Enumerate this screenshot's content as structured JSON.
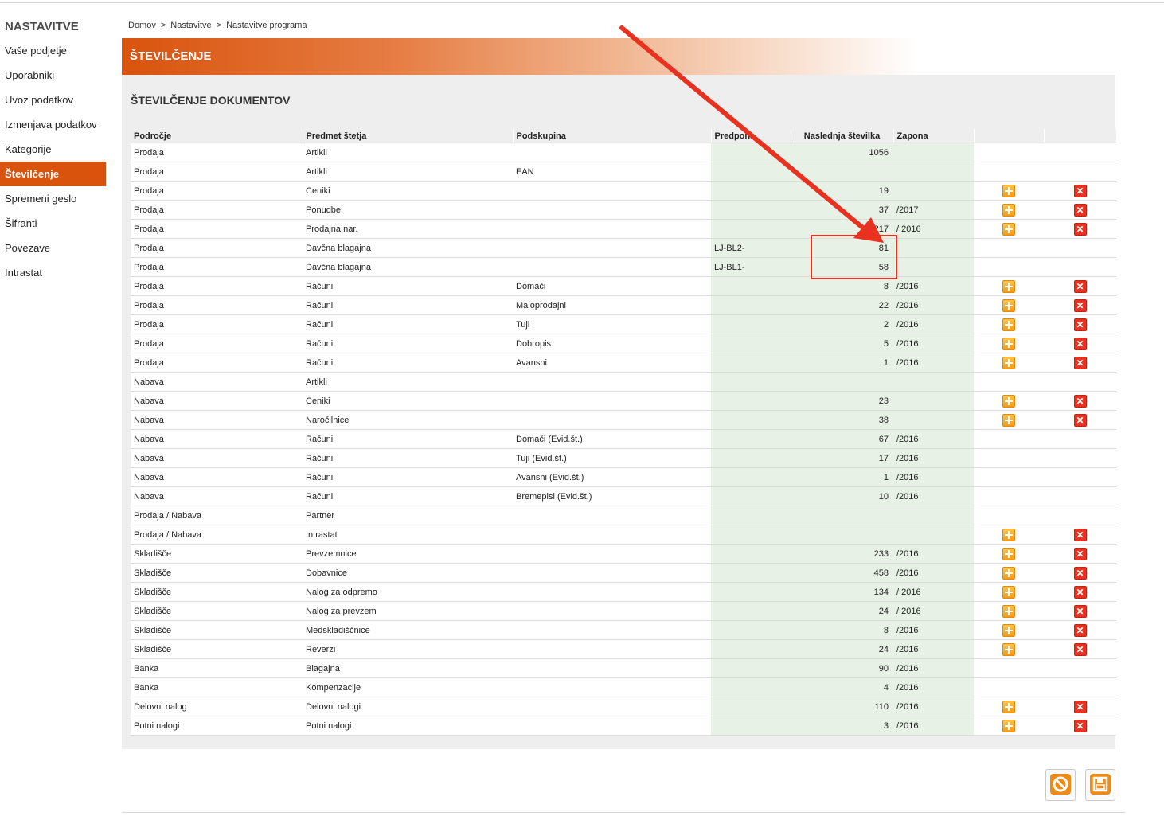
{
  "sidebar": {
    "title": "NASTAVITVE",
    "items": [
      {
        "label": "Vaše podjetje"
      },
      {
        "label": "Uporabniki"
      },
      {
        "label": "Uvoz podatkov"
      },
      {
        "label": "Izmenjava podatkov"
      },
      {
        "label": "Kategorije"
      },
      {
        "label": "Številčenje"
      },
      {
        "label": "Spremeni geslo"
      },
      {
        "label": "Šifranti"
      },
      {
        "label": "Povezave"
      },
      {
        "label": "Intrastat"
      }
    ],
    "active_item": "Številčenje"
  },
  "breadcrumb": [
    "Domov",
    "Nastavitve",
    "Nastavitve programa"
  ],
  "breadcrumb_separator": ">",
  "header": {
    "title": "ŠTEVILČENJE"
  },
  "section": {
    "title": "ŠTEVILČENJE DOKUMENTOV"
  },
  "table": {
    "columns": [
      "Področje",
      "Predmet štetja",
      "Podskupina",
      "Predpona",
      "Naslednja številka",
      "Zapona"
    ],
    "rows": [
      {
        "podrocje": "Prodaja",
        "predmet": "Artikli",
        "podskupina": "",
        "predpona": "",
        "stevilka": "1056",
        "zapona": "",
        "add": false,
        "del": false
      },
      {
        "podrocje": "Prodaja",
        "predmet": "Artikli",
        "podskupina": "EAN",
        "predpona": "",
        "stevilka": "",
        "zapona": "",
        "add": false,
        "del": false
      },
      {
        "podrocje": "Prodaja",
        "predmet": "Ceniki",
        "podskupina": "",
        "predpona": "",
        "stevilka": "19",
        "zapona": "",
        "add": true,
        "del": true
      },
      {
        "podrocje": "Prodaja",
        "predmet": "Ponudbe",
        "podskupina": "",
        "predpona": "",
        "stevilka": "37",
        "zapona": "/2017",
        "add": true,
        "del": true
      },
      {
        "podrocje": "Prodaja",
        "predmet": "Prodajna nar.",
        "podskupina": "",
        "predpona": "",
        "stevilka": "1217",
        "zapona": "/ 2016",
        "add": true,
        "del": true
      },
      {
        "podrocje": "Prodaja",
        "predmet": "Davčna blagajna",
        "podskupina": "",
        "predpona": "LJ-BL2-",
        "stevilka": "81",
        "zapona": "",
        "add": false,
        "del": false
      },
      {
        "podrocje": "Prodaja",
        "predmet": "Davčna blagajna",
        "podskupina": "",
        "predpona": "LJ-BL1-",
        "stevilka": "58",
        "zapona": "",
        "add": false,
        "del": false
      },
      {
        "podrocje": "Prodaja",
        "predmet": "Računi",
        "podskupina": "Domači",
        "predpona": "",
        "stevilka": "8",
        "zapona": "/2016",
        "add": true,
        "del": true
      },
      {
        "podrocje": "Prodaja",
        "predmet": "Računi",
        "podskupina": "Maloprodajni",
        "predpona": "",
        "stevilka": "22",
        "zapona": "/2016",
        "add": true,
        "del": true
      },
      {
        "podrocje": "Prodaja",
        "predmet": "Računi",
        "podskupina": "Tuji",
        "predpona": "",
        "stevilka": "2",
        "zapona": "/2016",
        "add": true,
        "del": true
      },
      {
        "podrocje": "Prodaja",
        "predmet": "Računi",
        "podskupina": "Dobropis",
        "predpona": "",
        "stevilka": "5",
        "zapona": "/2016",
        "add": true,
        "del": true
      },
      {
        "podrocje": "Prodaja",
        "predmet": "Računi",
        "podskupina": "Avansni",
        "predpona": "",
        "stevilka": "1",
        "zapona": "/2016",
        "add": true,
        "del": true
      },
      {
        "podrocje": "Nabava",
        "predmet": "Artikli",
        "podskupina": "",
        "predpona": "",
        "stevilka": "",
        "zapona": "",
        "add": false,
        "del": false
      },
      {
        "podrocje": "Nabava",
        "predmet": "Ceniki",
        "podskupina": "",
        "predpona": "",
        "stevilka": "23",
        "zapona": "",
        "add": true,
        "del": true
      },
      {
        "podrocje": "Nabava",
        "predmet": "Naročilnice",
        "podskupina": "",
        "predpona": "",
        "stevilka": "38",
        "zapona": "",
        "add": true,
        "del": true
      },
      {
        "podrocje": "Nabava",
        "predmet": "Računi",
        "podskupina": "Domači (Evid.št.)",
        "predpona": "",
        "stevilka": "67",
        "zapona": "/2016",
        "add": false,
        "del": false
      },
      {
        "podrocje": "Nabava",
        "predmet": "Računi",
        "podskupina": "Tuji (Evid.št.)",
        "predpona": "",
        "stevilka": "17",
        "zapona": "/2016",
        "add": false,
        "del": false
      },
      {
        "podrocje": "Nabava",
        "predmet": "Računi",
        "podskupina": "Avansni (Evid.št.)",
        "predpona": "",
        "stevilka": "1",
        "zapona": "/2016",
        "add": false,
        "del": false
      },
      {
        "podrocje": "Nabava",
        "predmet": "Računi",
        "podskupina": "Bremepisi (Evid.št.)",
        "predpona": "",
        "stevilka": "10",
        "zapona": "/2016",
        "add": false,
        "del": false
      },
      {
        "podrocje": "Prodaja / Nabava",
        "predmet": "Partner",
        "podskupina": "",
        "predpona": "",
        "stevilka": "",
        "zapona": "",
        "add": false,
        "del": false
      },
      {
        "podrocje": "Prodaja / Nabava",
        "predmet": "Intrastat",
        "podskupina": "",
        "predpona": "",
        "stevilka": "",
        "zapona": "",
        "add": true,
        "del": true
      },
      {
        "podrocje": "Skladišče",
        "predmet": "Prevzemnice",
        "podskupina": "",
        "predpona": "",
        "stevilka": "233",
        "zapona": "/2016",
        "add": true,
        "del": true
      },
      {
        "podrocje": "Skladišče",
        "predmet": "Dobavnice",
        "podskupina": "",
        "predpona": "",
        "stevilka": "458",
        "zapona": "/2016",
        "add": true,
        "del": true
      },
      {
        "podrocje": "Skladišče",
        "predmet": "Nalog za odpremo",
        "podskupina": "",
        "predpona": "",
        "stevilka": "134",
        "zapona": "/ 2016",
        "add": true,
        "del": true
      },
      {
        "podrocje": "Skladišče",
        "predmet": "Nalog za prevzem",
        "podskupina": "",
        "predpona": "",
        "stevilka": "24",
        "zapona": "/ 2016",
        "add": true,
        "del": true
      },
      {
        "podrocje": "Skladišče",
        "predmet": "Medskladiščnice",
        "podskupina": "",
        "predpona": "",
        "stevilka": "8",
        "zapona": "/2016",
        "add": true,
        "del": true
      },
      {
        "podrocje": "Skladišče",
        "predmet": "Reverzi",
        "podskupina": "",
        "predpona": "",
        "stevilka": "24",
        "zapona": "/2016",
        "add": true,
        "del": true
      },
      {
        "podrocje": "Banka",
        "predmet": "Blagajna",
        "podskupina": "",
        "predpona": "",
        "stevilka": "90",
        "zapona": "/2016",
        "add": false,
        "del": false
      },
      {
        "podrocje": "Banka",
        "predmet": "Kompenzacije",
        "podskupina": "",
        "predpona": "",
        "stevilka": "4",
        "zapona": "/2016",
        "add": false,
        "del": false
      },
      {
        "podrocje": "Delovni nalog",
        "predmet": "Delovni nalogi",
        "podskupina": "",
        "predpona": "",
        "stevilka": "110",
        "zapona": "/2016",
        "add": true,
        "del": true
      },
      {
        "podrocje": "Potni nalogi",
        "predmet": "Potni nalogi",
        "podskupina": "",
        "predpona": "",
        "stevilka": "3",
        "zapona": "/2016",
        "add": true,
        "del": true
      }
    ]
  },
  "icons": {
    "add": "plus-icon",
    "delete": "x-icon",
    "cancel": "cancel-icon",
    "save": "save-icon",
    "sidebar_add": "plus-icon"
  },
  "colors": {
    "accent": "#d9530d",
    "add": "#f39a1b",
    "delete": "#e8321f",
    "highlight": "#e8321f",
    "editable_cell": "#e8f1e6"
  }
}
